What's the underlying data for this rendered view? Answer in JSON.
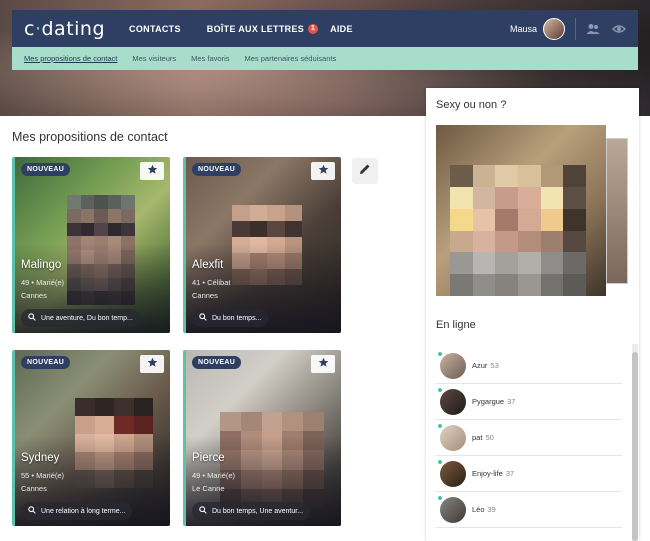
{
  "brand": {
    "logo_left": "c",
    "logo_dot": "·",
    "logo_right": "dating"
  },
  "nav": {
    "contacts": "CONTACTS",
    "mailbox": "BOÎTE AUX LETTRES",
    "mailbox_badge": "1",
    "help": "AIDE",
    "username": "Mausa"
  },
  "subnav": {
    "items": [
      "Mes propositions de contact",
      "Mes visiteurs",
      "Mes favoris",
      "Mes partenaires séduisants"
    ]
  },
  "main": {
    "title": "Mes propositions de contact"
  },
  "cards": [
    {
      "tag": "NOUVEAU",
      "name": "Malingo",
      "info": "49 • Marié(e)",
      "city": "Cannes",
      "pill": "Une aventure, Du bon temp..."
    },
    {
      "tag": "NOUVEAU",
      "name": "Alexfit",
      "info": "41 • Célibat",
      "city": "Cannes",
      "pill": "Du bon temps..."
    },
    {
      "tag": "NOUVEAU",
      "name": "Sydney",
      "info": "55 • Marié(e)",
      "city": "Cannes",
      "pill": "Une relation à long terme..."
    },
    {
      "tag": "NOUVEAU",
      "name": "Pierce",
      "info": "49 • Marié(e)",
      "city": "Le Canne",
      "pill": "Du bon temps, Une aventur..."
    }
  ],
  "sidebar": {
    "sexy_title": "Sexy ou non ?",
    "online_title": "En ligne",
    "online": [
      {
        "name": "Azur",
        "age": "53"
      },
      {
        "name": "Pygargue",
        "age": "37"
      },
      {
        "name": "pat",
        "age": "50"
      },
      {
        "name": "Enjoy-life",
        "age": "37"
      },
      {
        "name": "Léo",
        "age": "39"
      }
    ]
  },
  "colors": {
    "nav": "#2e3f63",
    "subnav": "#a8dccb",
    "accent": "#5fc1a5",
    "badge": "#e2574c"
  }
}
